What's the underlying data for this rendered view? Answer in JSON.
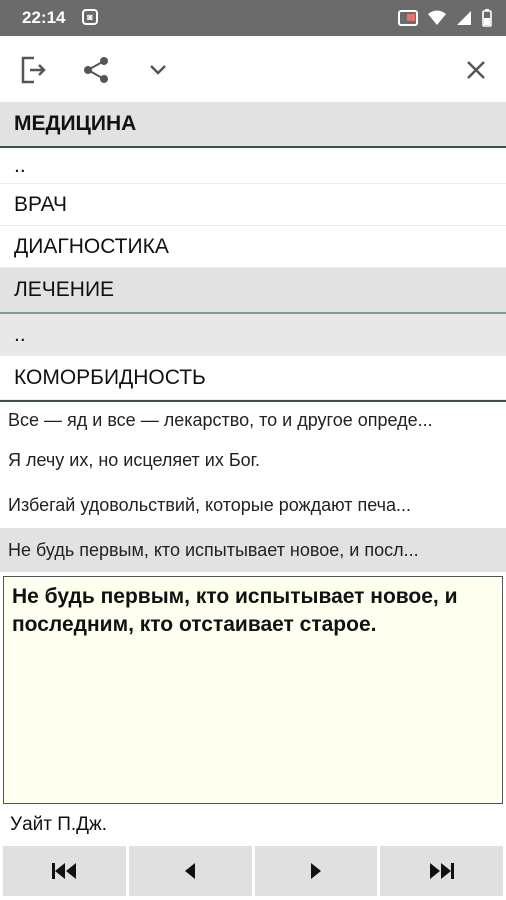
{
  "status": {
    "time": "22:14"
  },
  "toolbar": {
    "exit_icon": "exit-icon",
    "share_icon": "share-icon",
    "expand_icon": "chevron-down-icon",
    "close_icon": "close-icon"
  },
  "sections": {
    "medicine": "МЕДИЦИНА",
    "up1": "..",
    "doctor": "ВРАЧ",
    "diagnostics": "ДИАГНОСТИКА",
    "treatment": "ЛЕЧЕНИЕ",
    "up2": "..",
    "comorbidity": "КОМОРБИДНОСТЬ"
  },
  "quotes": [
    "Все — яд и все — лекарство, то и другое опреде...",
    "Я лечу их, но исцеляет их Бог.",
    "Избегай удовольствий, которые рождают печа...",
    "Не будь первым, кто испытывает новое, и посл..."
  ],
  "detail": {
    "text": "Не будь первым, кто испытывает новое, и последним, кто отстаивает старое.",
    "author": "Уайт П.Дж."
  },
  "colors": {
    "header_bg": "#e2e2e2",
    "detail_bg": "#fffff0",
    "statusbar": "#6b6b6b"
  }
}
